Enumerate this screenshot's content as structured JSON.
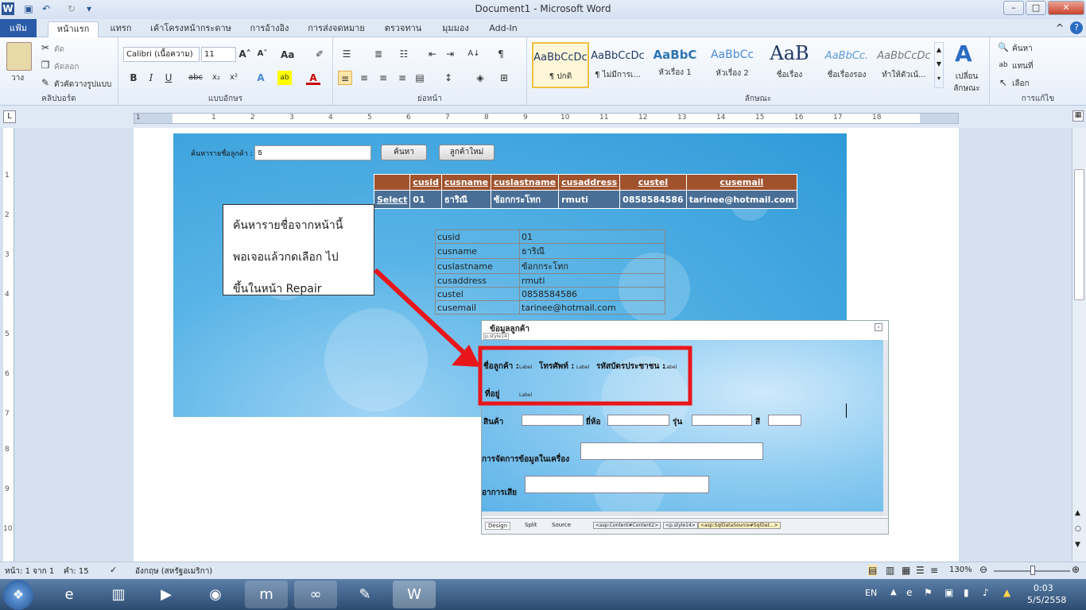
{
  "window": {
    "title": "Document1 - Microsoft Word",
    "minimize": "–",
    "maximize": "□",
    "close": "✕"
  },
  "tabs": [
    "แฟ้ม",
    "หน้าแรก",
    "แทรก",
    "เค้าโครงหน้ากระดาษ",
    "การอ้างอิง",
    "การส่งจดหมาย",
    "ตรวจทาน",
    "มุมมอง",
    "Add-In"
  ],
  "ribbon": {
    "clipboard": {
      "paste": "วาง",
      "cut": "ตัด",
      "copy": "คัดลอก",
      "format_painter": "ตัวคัดวางรูปแบบ",
      "label": "คลิปบอร์ด"
    },
    "font": {
      "font_name": "Calibri (เนื้อความ)",
      "font_size": "11",
      "label": "แบบอักษร",
      "aa": "Aa"
    },
    "paragraph": {
      "label": "ย่อหน้า"
    },
    "styles": {
      "label": "ลักษณะ",
      "items": [
        {
          "preview": "AaBbCcDc",
          "name": "¶ ปกติ"
        },
        {
          "preview": "AaBbCcDc",
          "name": "¶ ไม่มีการเ..."
        },
        {
          "preview": "AaBbC",
          "name": "หัวเรื่อง 1"
        },
        {
          "preview": "AaBbCc",
          "name": "หัวเรื่อง 2"
        },
        {
          "preview": "AaB",
          "name": "ชื่อเรื่อง"
        },
        {
          "preview": "AaBbCc.",
          "name": "ชื่อเรื่องรอง"
        },
        {
          "preview": "AaBbCcDc",
          "name": "ทำให้ตัวเน้..."
        }
      ],
      "change_styles": "เปลี่ยน ลักษณะ"
    },
    "editing": {
      "find": "ค้นหา",
      "replace": "แทนที่",
      "select": "เลือก",
      "label": "การแก้ไข"
    }
  },
  "ruler_numbers": [
    "1",
    "1",
    "2",
    "3",
    "4",
    "5",
    "6",
    "7",
    "8",
    "9",
    "10",
    "11",
    "12",
    "13",
    "14",
    "15",
    "16",
    "17",
    "18"
  ],
  "vruler_numbers": [
    "1",
    "2",
    "3",
    "4",
    "5",
    "6",
    "7",
    "8",
    "9",
    "10"
  ],
  "shot1": {
    "search_label": "ค้นหารายชื่อลูกค้า :",
    "search_value": "ธ",
    "search_button": "ค้นหา",
    "new_button": "ลูกค้าใหม่",
    "grid_headers": [
      "cusid",
      "cusname",
      "cuslastname",
      "cusaddress",
      "custel",
      "cusemail"
    ],
    "grid_row": {
      "select": "Select",
      "cells": [
        "01",
        "ธาริณี",
        "ซ้อกกระโทก",
        "rmuti",
        "0858584586",
        "tarinee@hotmail.com"
      ]
    },
    "detail": [
      [
        "cusid",
        "01"
      ],
      [
        "cusname",
        "ธาริณี"
      ],
      [
        "cuslastname",
        "ซ้อกกระโทก"
      ],
      [
        "cusaddress",
        "rmuti"
      ],
      [
        "custel",
        "0858584586"
      ],
      [
        "cusemail",
        "tarinee@hotmail.com"
      ]
    ]
  },
  "callout": [
    "ค้นหารายชื่อจากหน้านี้",
    "พอเจอแล้วกดเลือก ไป",
    "ขึ้นในหน้า Repair"
  ],
  "shot2": {
    "header": "ข้อมูลลูกค้า",
    "tag": "p.style14",
    "customer": "ชื่อลูกค้า :",
    "phone": "โทรศัพท์ :",
    "idcard": "รหัสบัตรประชาชน :",
    "address": "ที่อยู่",
    "label": "Label",
    "product": "สินค้า",
    "brand": "ยี่ห้อ",
    "model": "รุ่น",
    "color": "สี",
    "data_mgmt": "การจัดการข้อมูลในเครื่อง",
    "symptom": "อาการเสีย",
    "footer_tabs": [
      "Design",
      "Split",
      "Source"
    ],
    "footer_crumbs": [
      "<asp:Content#Content2>",
      "<p.style14>",
      "<asp:SqlDataSource#SqlDat...>"
    ]
  },
  "status": {
    "page": "หน้า: 1 จาก 1",
    "words": "คำ: 15",
    "lang": "อังกฤษ (สหรัฐอเมริกา)",
    "zoom": "130%"
  },
  "taskbar": {
    "lang": "EN",
    "time": "0:03",
    "date": "5/5/2558"
  },
  "colors": {
    "arrow": "#e8161b",
    "grid_header": "#a0522d",
    "file_tab": "#2a5ba8"
  }
}
